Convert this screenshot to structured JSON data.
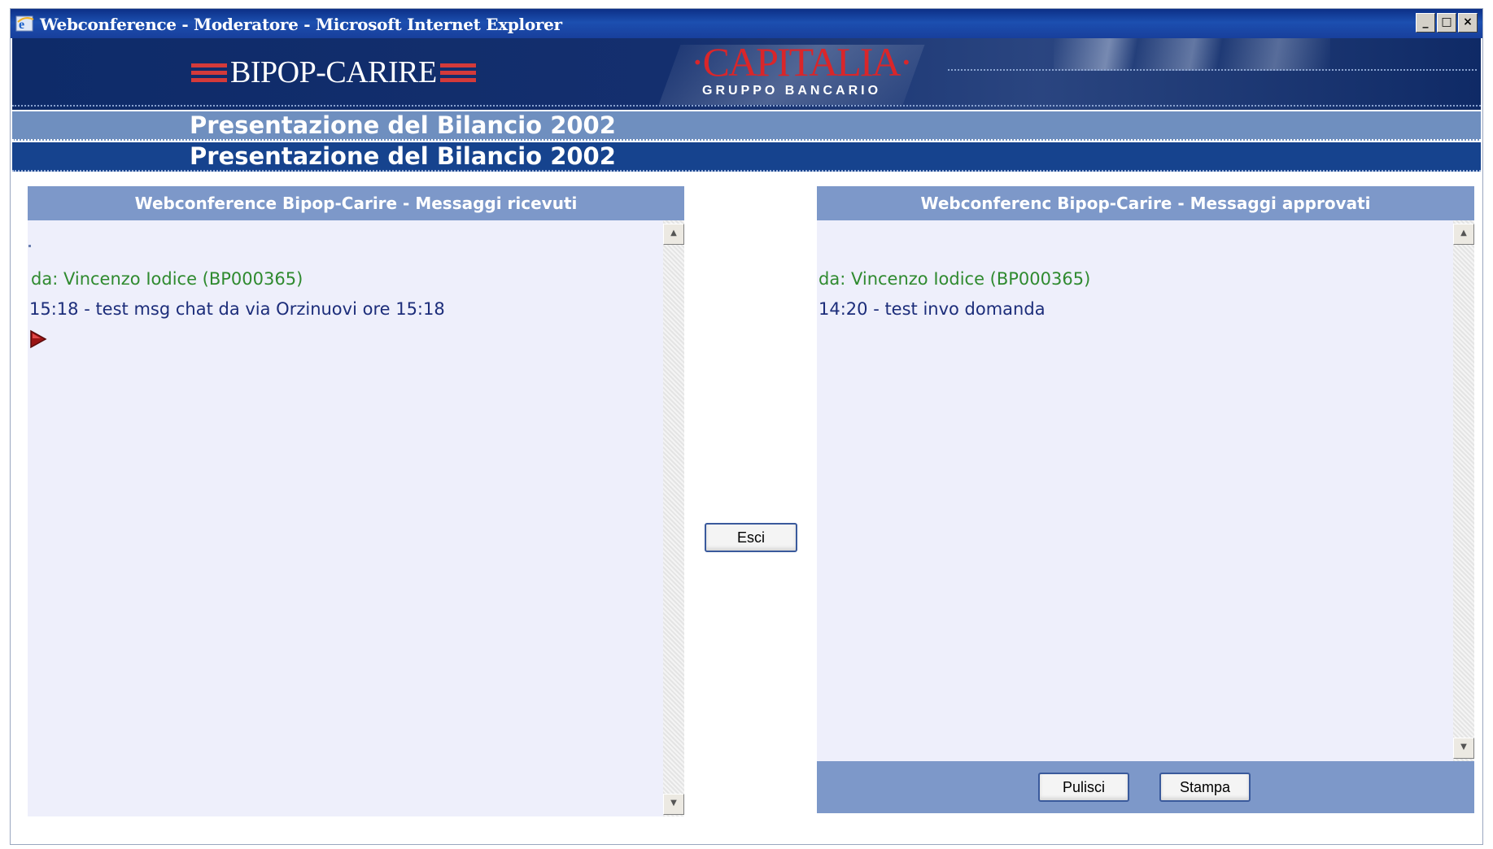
{
  "window": {
    "title": "Webconference - Moderatore - Microsoft Internet Explorer",
    "controls": [
      "minimize",
      "maximize",
      "close"
    ]
  },
  "banner": {
    "bipop_logo": "BIPOP-CARIRE",
    "capitalia_logo": "·CAPITALIA·",
    "gruppo": "GRUPPO BANCARIO"
  },
  "presentation": {
    "title_1": "Presentazione del Bilancio 2002",
    "title_2": "Presentazione del Bilancio 2002"
  },
  "left_panel": {
    "header": "Webconference Bipop-Carire - Messaggi ricevuti",
    "messages": [
      {
        "sender": "da: Vincenzo Iodice (BP000365)",
        "text": "15:18 - test msg chat da via Orzinuovi ore 15:18"
      }
    ]
  },
  "center": {
    "exit_label": "Esci"
  },
  "right_panel": {
    "header": "Webconferenc Bipop-Carire - Messaggi approvati",
    "messages": [
      {
        "sender": "da: Vincenzo Iodice (BP000365)",
        "text": "14:20 - test invo domanda"
      }
    ],
    "clear_label": "Pulisci",
    "print_label": "Stampa"
  },
  "colors": {
    "sender_green": "#2f8a2f",
    "message_blue": "#1c2d7a",
    "panel_header": "#7d98c9",
    "panel_body": "#eeeffb",
    "titlebar": "#1c4fb0"
  },
  "icons": [
    "ie-icon",
    "play-arrow-icon",
    "scroll-up-icon",
    "scroll-down-icon"
  ]
}
